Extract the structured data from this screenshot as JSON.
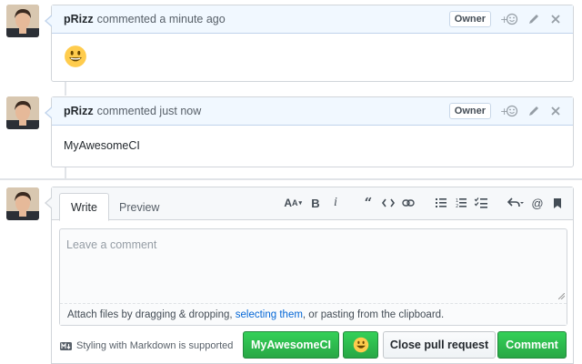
{
  "comments": [
    {
      "author": "pRizz",
      "action": "commented a minute ago",
      "badge": "Owner",
      "body_emoji": "smiley"
    },
    {
      "author": "pRizz",
      "action": "commented just now",
      "badge": "Owner",
      "body_text": "MyAwesomeCI"
    }
  ],
  "editor": {
    "tabs": [
      "Write",
      "Preview"
    ],
    "active_tab": "Write",
    "toolbar_icons": [
      "text-size-icon",
      "bold-icon",
      "italic-icon",
      "quote-icon",
      "code-icon",
      "link-icon",
      "bulleted-list-icon",
      "numbered-list-icon",
      "task-list-icon",
      "reply-icon",
      "mention-icon",
      "bookmark-icon"
    ],
    "placeholder": "Leave a comment",
    "value": "",
    "attach_prefix": "Attach files by dragging & dropping, ",
    "attach_link": "selecting them",
    "attach_suffix": ", or pasting from the clipboard.",
    "markdown_hint": "Styling with Markdown is supported"
  },
  "buttons": {
    "custom": "MyAwesomeCI",
    "emoji": "smiley",
    "close": "Close pull request",
    "comment": "Comment"
  },
  "colors": {
    "header_bg": "#f1f8ff",
    "green": "#28a745",
    "link": "#0366d6",
    "emoji_yellow": "#ffcc4d"
  }
}
